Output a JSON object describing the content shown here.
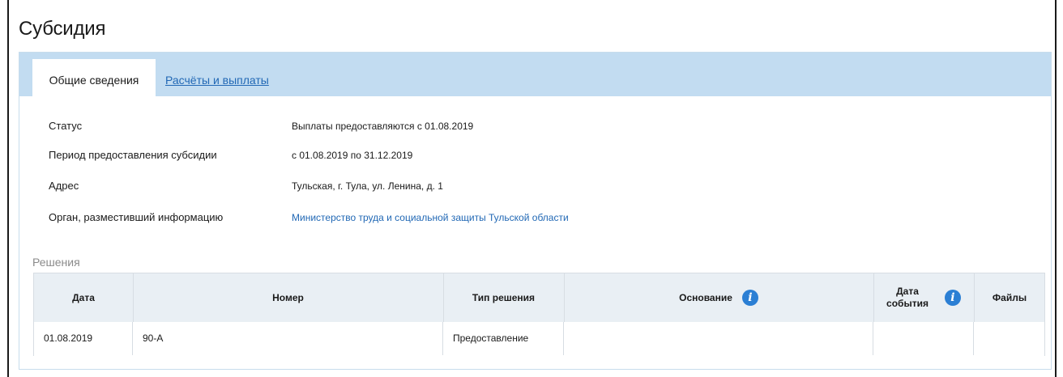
{
  "page": {
    "title": "Субсидия"
  },
  "tabs": [
    {
      "label": "Общие сведения",
      "active": true
    },
    {
      "label": "Расчёты и выплаты",
      "active": false
    }
  ],
  "info": [
    {
      "label": "Статус",
      "value": "Выплаты предоставляются с 01.08.2019"
    },
    {
      "label": "Период предоставления субсидии",
      "value": "с 01.08.2019 по 31.12.2019"
    },
    {
      "label": "Адрес",
      "value": "Тульская, г. Тула, ул. Ленина, д. 1"
    },
    {
      "label": "Орган, разместивший информацию",
      "value": "Министерство труда и социальной защиты Тульской области"
    }
  ],
  "decisions": {
    "title": "Решения",
    "columns": {
      "date": "Дата",
      "number": "Номер",
      "type": "Тип решения",
      "basis": "Основание",
      "event_date_line1": "Дата",
      "event_date_line2": "события",
      "files": "Файлы"
    },
    "rows": [
      {
        "date": "01.08.2019",
        "number": "90-А",
        "type": "Предоставление",
        "basis": "",
        "event_date": "",
        "files": ""
      }
    ]
  },
  "colors": {
    "link": "#2168b5",
    "tabbar": "#c2dcf1",
    "table_header": "#e9eff4",
    "info_icon": "#2b7fd4"
  }
}
